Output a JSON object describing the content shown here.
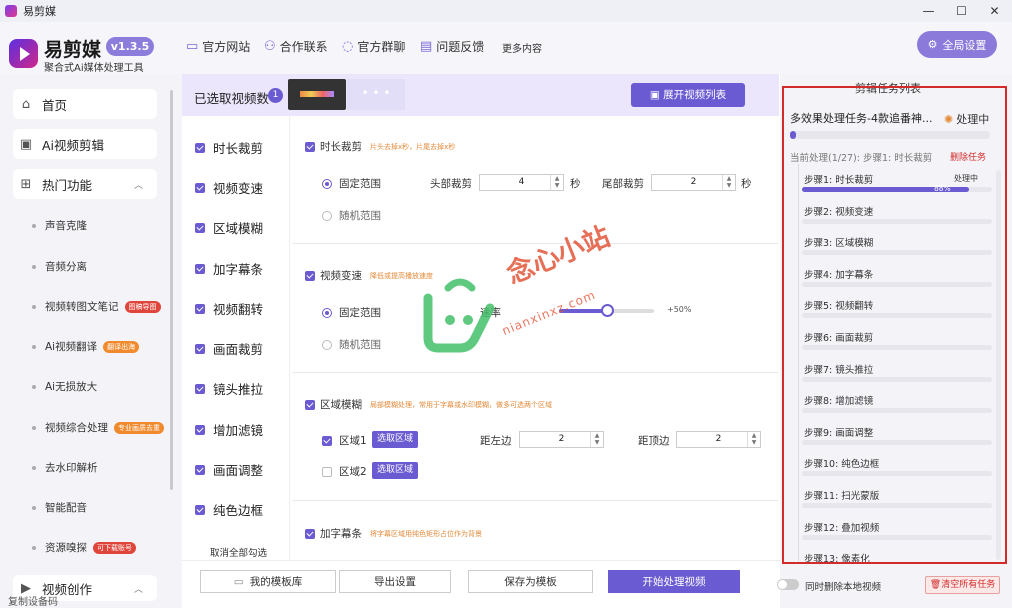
{
  "window": {
    "title": "易剪媒"
  },
  "header": {
    "brand": "易剪媒",
    "version": "v1.3.5",
    "subtitle": "聚合式Ai媒体处理工具",
    "nav": [
      {
        "label": "官方网站",
        "icon": "monitor-icon"
      },
      {
        "label": "合作联系",
        "icon": "users-icon"
      },
      {
        "label": "官方群聊",
        "icon": "chat-icon"
      },
      {
        "label": "问题反馈",
        "icon": "feedback-icon"
      }
    ],
    "more": "更多内容",
    "global_settings": "全局设置"
  },
  "sidebar": {
    "home": "首页",
    "ai_edit": "Ai视频剪辑",
    "hot": "热门功能",
    "items": [
      {
        "label": "声音克隆",
        "badge": ""
      },
      {
        "label": "音频分离",
        "badge": ""
      },
      {
        "label": "视频转图文笔记",
        "badge": "图稿导图",
        "badge_color": "#e0453c"
      },
      {
        "label": "Ai视频翻译",
        "badge": "翻译出海",
        "badge_color": "#f08a2c"
      },
      {
        "label": "Ai无损放大",
        "badge": ""
      },
      {
        "label": "视频综合处理",
        "badge": "专业画质去重",
        "badge_color": "#f08a2c"
      },
      {
        "label": "去水印解析",
        "badge": ""
      },
      {
        "label": "智能配音",
        "badge": ""
      },
      {
        "label": "资源嗅探",
        "badge": "可下载账号",
        "badge_color": "#e0453c"
      }
    ],
    "creation": "视频创作",
    "footer": "复制设备码"
  },
  "main": {
    "selected_label": "已选取视频数",
    "selected_count": "1",
    "expand_button": "展开视频列表",
    "features": [
      "时长裁剪",
      "视频变速",
      "区域模糊",
      "加字幕条",
      "视频翻转",
      "画面裁剪",
      "镜头推拉",
      "增加滤镜",
      "画面调整",
      "纯色边框"
    ],
    "uncheck_all": "取消全部勾选",
    "trim": {
      "title": "时长裁剪",
      "desc": "片头去掉x秒，片尾去掉x秒",
      "fixed": "固定范围",
      "random": "随机范围",
      "head_label": "头部裁剪",
      "head_value": "4",
      "tail_label": "尾部裁剪",
      "tail_value": "2",
      "unit": "秒"
    },
    "speed": {
      "title": "视频变速",
      "desc": "降低或提高播放速度",
      "fixed": "固定范围",
      "random": "随机范围",
      "rate_label": "速率",
      "rate_value": "+50%",
      "slider_fraction": 0.5
    },
    "blur": {
      "title": "区域模糊",
      "desc": "局部模糊处理，常用于字幕或水印模糊，做多可选两个区域",
      "area1": "区域1",
      "area2": "区域2",
      "select_area": "选取区域",
      "left_label": "距左边",
      "left_value": "2",
      "top_label": "距顶边",
      "top_value": "2"
    },
    "subtitle": {
      "title": "加字幕条",
      "desc": "将字幕区域用纯色矩形占位作为背景"
    },
    "bottom": {
      "templates": "我的模板库",
      "export": "导出设置",
      "save_template": "保存为模板",
      "start": "开始处理视频"
    }
  },
  "tasks": {
    "title": "剪辑任务列表",
    "task_name": "多效果处理任务-4款追番神...",
    "status": "处理中",
    "current": "当前处理(1/27): 步骤1: 时长裁剪",
    "delete": "删除任务",
    "overall_progress": 0.03,
    "steps": [
      {
        "label": "步骤1: 时长裁剪",
        "progress": 0.88,
        "percent": "88%",
        "status": "处理中"
      },
      {
        "label": "步骤2: 视频变速",
        "progress": 0
      },
      {
        "label": "步骤3: 区域模糊",
        "progress": 0
      },
      {
        "label": "步骤4: 加字幕条",
        "progress": 0
      },
      {
        "label": "步骤5: 视频翻转",
        "progress": 0
      },
      {
        "label": "步骤6: 画面裁剪",
        "progress": 0
      },
      {
        "label": "步骤7: 镜头推拉",
        "progress": 0
      },
      {
        "label": "步骤8: 增加滤镜",
        "progress": 0
      },
      {
        "label": "步骤9: 画面调整",
        "progress": 0
      },
      {
        "label": "步骤10: 纯色边框",
        "progress": 0
      },
      {
        "label": "步骤11: 扫光蒙版",
        "progress": 0
      },
      {
        "label": "步骤12: 叠加视频",
        "progress": 0
      },
      {
        "label": "步骤13: 像素化",
        "progress": 0
      }
    ],
    "sync_delete": "同时删除本地视频",
    "clear_all": "清空所有任务"
  },
  "watermark": {
    "text": "念心小站",
    "url": "nianxinxz.com"
  },
  "colors": {
    "accent": "#6b5bd2",
    "button": "#8b7ad9",
    "warning": "#e38a3a",
    "danger": "#d42a2a"
  }
}
